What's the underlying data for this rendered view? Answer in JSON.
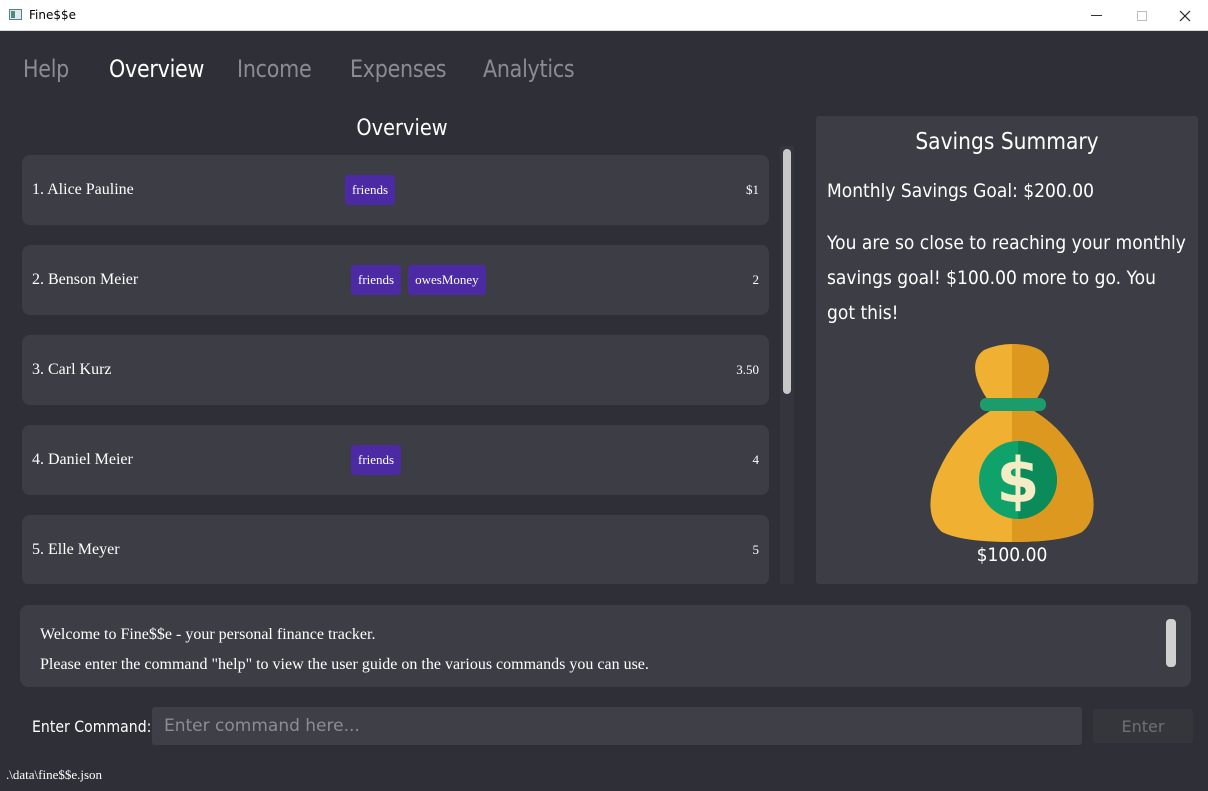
{
  "window": {
    "title": "Fine$$e",
    "icon": "app-window-icon"
  },
  "tabs": [
    {
      "label": "Help",
      "active": false
    },
    {
      "label": "Overview",
      "active": true
    },
    {
      "label": "Income",
      "active": false
    },
    {
      "label": "Expenses",
      "active": false
    },
    {
      "label": "Analytics",
      "active": false
    }
  ],
  "overview": {
    "title": "Overview",
    "items": [
      {
        "name": "1. Alice Pauline",
        "tags": [
          "friends"
        ],
        "amount": "$1"
      },
      {
        "name": "2. Benson Meier",
        "tags": [
          "friends",
          "owesMoney"
        ],
        "amount": "2"
      },
      {
        "name": "3. Carl Kurz",
        "tags": [],
        "amount": "3.50"
      },
      {
        "name": "4. Daniel Meier",
        "tags": [
          "friends"
        ],
        "amount": "4"
      },
      {
        "name": "5. Elle Meyer",
        "tags": [],
        "amount": "5"
      }
    ]
  },
  "savings": {
    "title": "Savings Summary",
    "goal_text": "Monthly Savings Goal: $200.00",
    "message": "You are so close to reaching your monthly savings goal! $100.00 more to go. You got this!",
    "amount": "$100.00",
    "icon": "money-bag-icon"
  },
  "result": {
    "lines": [
      "Welcome to Fine$$e - your personal finance tracker.",
      "Please enter the command \"help\" to view the user guide on the various commands you can use."
    ]
  },
  "command": {
    "label": "Enter Command:",
    "placeholder": "Enter command here...",
    "value": "",
    "button_label": "Enter"
  },
  "status": {
    "path": ".\\data\\fine$$e.json"
  },
  "colors": {
    "background": "#2f3037",
    "card": "#3c3d45",
    "tag": "#4b2aa3",
    "bag": "#f0b132",
    "coin": "#0fa36b"
  }
}
